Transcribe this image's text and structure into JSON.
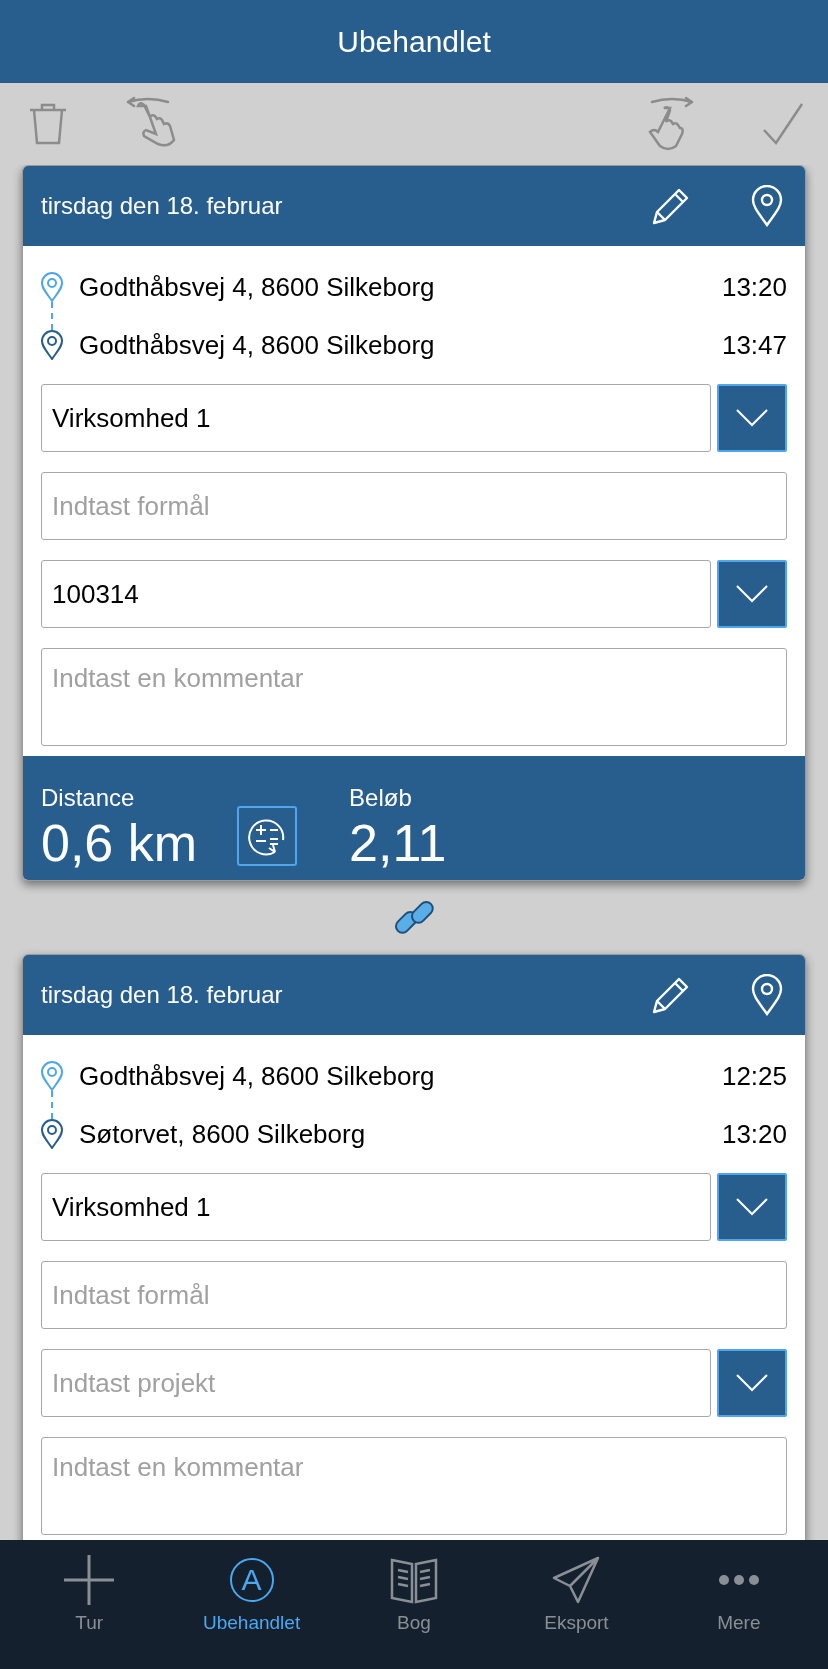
{
  "header": {
    "title": "Ubehandlet"
  },
  "trips": [
    {
      "date": "tirsdag den 18. februar",
      "linked_to_next": true,
      "stops": [
        {
          "kind": "start",
          "address": "Godthåbsvej 4, 8600 Silkeborg",
          "time": "13:20"
        },
        {
          "kind": "end",
          "address": "Godthåbsvej 4, 8600 Silkeborg",
          "time": "13:47"
        }
      ],
      "fields": [
        {
          "kind": "select",
          "value": "Virksomhed 1"
        },
        {
          "kind": "text",
          "placeholder": "Indtast formål"
        },
        {
          "kind": "select",
          "value": "100314"
        },
        {
          "kind": "textarea",
          "placeholder": "Indtast en kommentar"
        }
      ],
      "summary": {
        "distance_label": "Distance",
        "distance": "0,6 km",
        "amount_label": "Beløb",
        "amount": "2,11"
      }
    },
    {
      "date": "tirsdag den 18. februar",
      "stops": [
        {
          "kind": "start",
          "address": "Godthåbsvej 4, 8600 Silkeborg",
          "time": "12:25"
        },
        {
          "kind": "end",
          "address": "Søtorvet, 8600 Silkeborg",
          "time": "13:20"
        }
      ],
      "fields": [
        {
          "kind": "select",
          "value": "Virksomhed 1"
        },
        {
          "kind": "text",
          "placeholder": "Indtast formål"
        },
        {
          "kind": "select",
          "placeholder": "Indtast projekt"
        },
        {
          "kind": "textarea",
          "placeholder": "Indtast en kommentar"
        }
      ]
    }
  ],
  "tabs": [
    {
      "kind": "plus",
      "label": "Tur",
      "selected": false
    },
    {
      "kind": "letter",
      "letter": "A",
      "label": "Ubehandlet",
      "selected": true
    },
    {
      "kind": "book",
      "label": "Bog",
      "selected": false
    },
    {
      "kind": "send",
      "label": "Eksport",
      "selected": false
    },
    {
      "kind": "more",
      "label": "Mere",
      "selected": false
    }
  ]
}
